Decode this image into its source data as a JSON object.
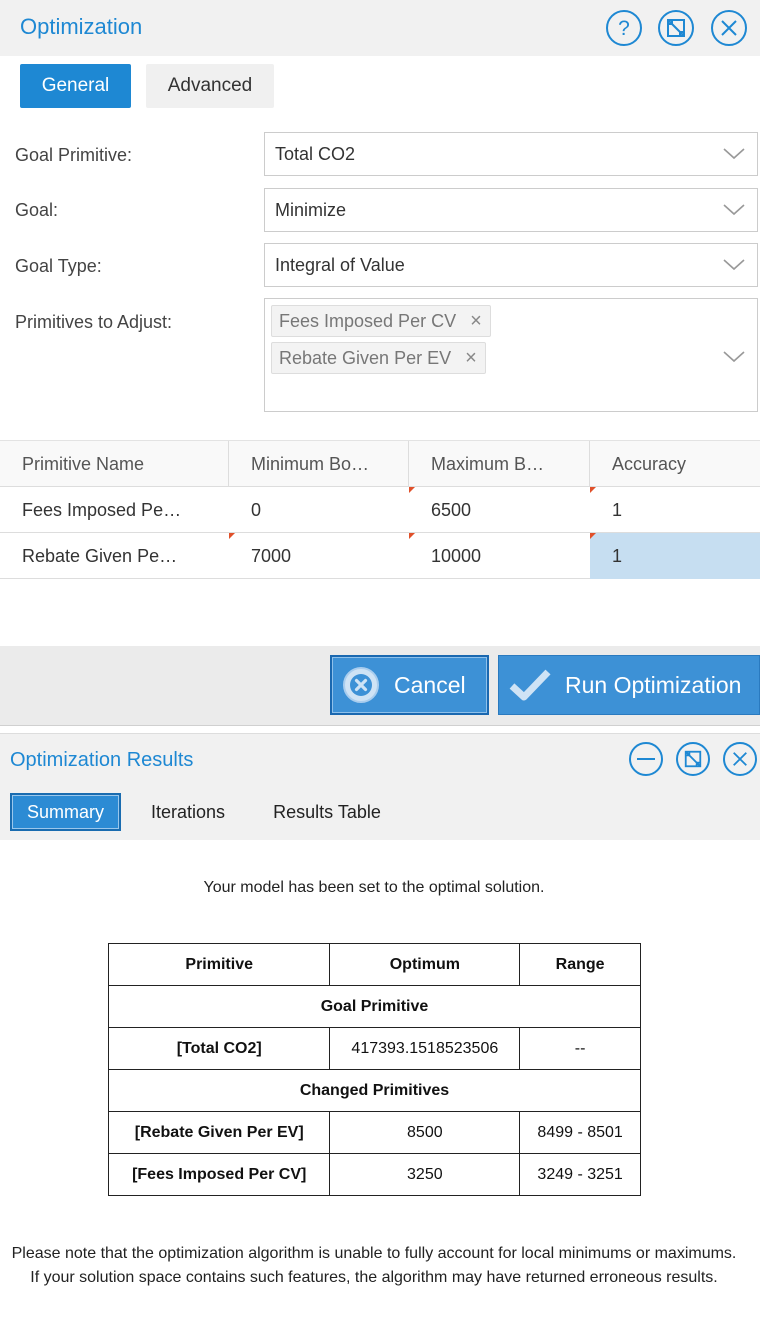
{
  "optimization": {
    "title": "Optimization",
    "tabs": {
      "general": "General",
      "advanced": "Advanced"
    },
    "form": {
      "goal_primitive_label": "Goal Primitive:",
      "goal_primitive_value": "Total CO2",
      "goal_label": "Goal:",
      "goal_value": "Minimize",
      "goal_type_label": "Goal Type:",
      "goal_type_value": "Integral of Value",
      "primitives_label": "Primitives to Adjust:",
      "primitives_selected": [
        "Fees Imposed Per CV",
        "Rebate Given Per EV"
      ],
      "chip_remove": "×"
    },
    "grid": {
      "columns": [
        "Primitive Name",
        "Minimum Bo…",
        "Maximum B…",
        "Accuracy"
      ],
      "rows": [
        [
          "Fees Imposed Pe…",
          "0",
          "6500",
          "1"
        ],
        [
          "Rebate Given Pe…",
          "7000",
          "10000",
          "1"
        ]
      ]
    },
    "buttons": {
      "cancel": "Cancel",
      "run": "Run Optimization"
    }
  },
  "results": {
    "title": "Optimization Results",
    "tabs": {
      "summary": "Summary",
      "iterations": "Iterations",
      "results_table": "Results Table"
    },
    "message": "Your model has been set to the optimal solution.",
    "table": {
      "headers": [
        "Primitive",
        "Optimum",
        "Range"
      ],
      "goal_section": "Goal Primitive",
      "goal_row": [
        "[Total CO2]",
        "417393.1518523506",
        "--"
      ],
      "changed_section": "Changed Primitives",
      "changed_rows": [
        [
          "[Rebate Given Per EV]",
          "8500",
          "8499 - 8501"
        ],
        [
          "[Fees Imposed Per CV]",
          "3250",
          "3249 - 3251"
        ]
      ]
    },
    "note": "Please note that the optimization algorithm is unable to fully account for local minimums or maximums. If your solution space contains such features, the algorithm may have returned erroneous results."
  },
  "colors": {
    "accent": "#1e88d3",
    "selected_cell": "#c6def1",
    "button": "#3d91d6"
  }
}
